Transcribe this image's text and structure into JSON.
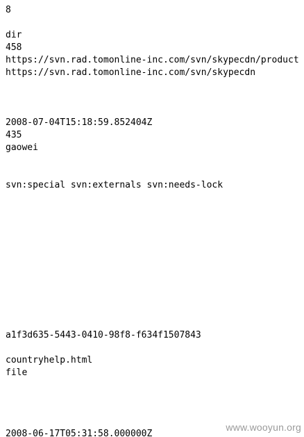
{
  "lines": [
    "8",
    "dir",
    "458",
    "https://svn.rad.tomonline-inc.com/svn/skypecdn/product",
    "https://svn.rad.tomonline-inc.com/svn/skypecdn",
    "2008-07-04T15:18:59.852404Z",
    "435",
    "gaowei",
    "svn:special svn:externals svn:needs-lock",
    "a1f3d635-5443-0410-98f8-f634f1507843",
    "countryhelp.html",
    "file",
    "2008-06-17T05:31:58.000000Z"
  ],
  "watermark": "www.wooyun.org",
  "colors": {
    "background": "#ffffff",
    "text": "#000000",
    "watermark": "#9a9a9a"
  }
}
